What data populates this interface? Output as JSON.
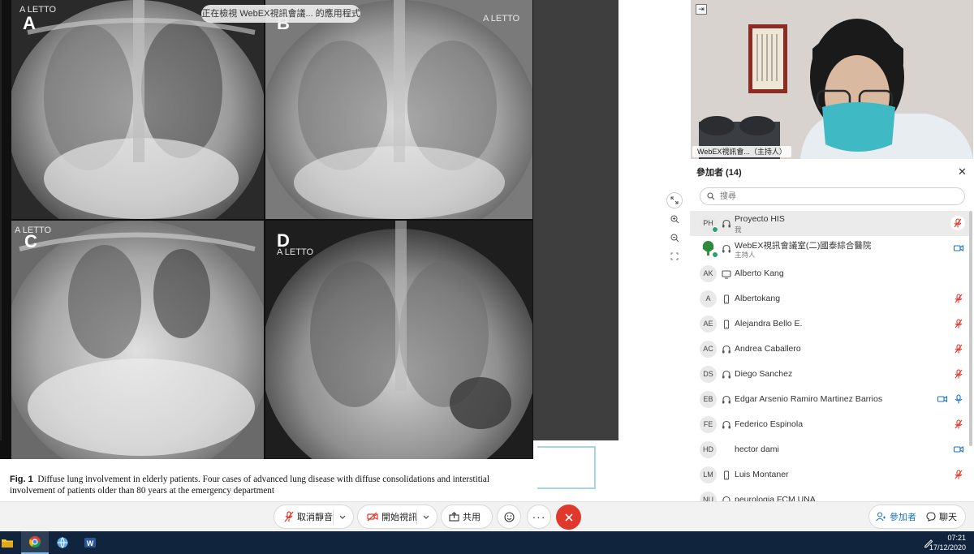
{
  "share": {
    "viewing_banner": "正在檢視 WebEX視訊會議... 的應用程式",
    "panels": [
      {
        "letter": "A",
        "tag": "A LETTO"
      },
      {
        "letter": "B",
        "tag": "A LETTO"
      },
      {
        "letter": "C",
        "tag": "A LETTO"
      },
      {
        "letter": "D",
        "tag": "A LETTO"
      }
    ],
    "caption_prefix": "Fig. 1",
    "caption_text": "Diffuse lung involvement in elderly patients. Four cases of advanced lung disease with diffuse consolidations and interstitial involvement of patients older than 80 years at the emergency department"
  },
  "video": {
    "label": "WebEX視訊會...",
    "label_role": "（主持人）"
  },
  "participants": {
    "header": "參加者 (14)",
    "search_placeholder": "搜尋",
    "items": [
      {
        "initials": "PH",
        "name": "Proyecto HIS",
        "sub": "我",
        "device": "headset-icon",
        "right": [
          "mic-muted-icon"
        ]
      },
      {
        "initials": "",
        "name": "WebEX視訊會議室(二)國泰綜合醫院",
        "sub": "主持人",
        "device": "headset-icon",
        "right": [
          "video-icon"
        ]
      },
      {
        "initials": "AK",
        "name": "Alberto Kang",
        "sub": "",
        "device": "desktop-icon",
        "right": []
      },
      {
        "initials": "A",
        "name": "Albertokang",
        "sub": "",
        "device": "phone-icon",
        "right": [
          "mic-muted-icon"
        ]
      },
      {
        "initials": "AE",
        "name": "Alejandra Bello E.",
        "sub": "",
        "device": "phone-icon",
        "right": [
          "mic-muted-icon"
        ]
      },
      {
        "initials": "AC",
        "name": "Andrea Caballero",
        "sub": "",
        "device": "headset-icon",
        "right": [
          "mic-muted-icon"
        ]
      },
      {
        "initials": "DS",
        "name": "Diego Sanchez",
        "sub": "",
        "device": "headset-icon",
        "right": [
          "mic-muted-icon"
        ]
      },
      {
        "initials": "EB",
        "name": "Edgar Arsenio Ramiro Martinez Barrios",
        "sub": "",
        "device": "headset-icon",
        "right": [
          "video-icon",
          "mic-icon"
        ]
      },
      {
        "initials": "FE",
        "name": "Federico Espinola",
        "sub": "",
        "device": "headset-icon",
        "right": [
          "mic-muted-icon"
        ]
      },
      {
        "initials": "HD",
        "name": "hector dami",
        "sub": "",
        "device": "",
        "right": [
          "video-icon"
        ]
      },
      {
        "initials": "LM",
        "name": "Luis Montaner",
        "sub": "",
        "device": "phone-icon",
        "right": [
          "mic-muted-icon"
        ]
      },
      {
        "initials": "NU",
        "name": "neurologia FCM UNA",
        "sub": "",
        "device": "headset-icon",
        "right": []
      }
    ]
  },
  "toolbar": {
    "unmute_label": "取消靜音",
    "start_video_label": "開始視訊",
    "share_label": "共用",
    "participants_label": "參加者",
    "chat_label": "聊天"
  },
  "taskbar": {
    "time": "07:21",
    "date": "17/12/2020"
  },
  "colors": {
    "accent": "#1a73c8",
    "muted_red": "#e0382d",
    "taskbar": "#10253d"
  }
}
